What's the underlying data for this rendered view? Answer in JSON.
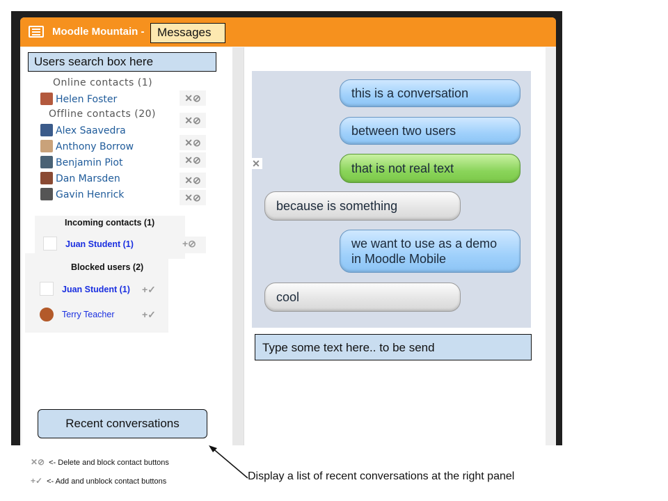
{
  "header": {
    "site_title": "Moodle Mountain -",
    "messages_callout": "Messages"
  },
  "search": {
    "callout": "Users search box here"
  },
  "contacts": {
    "online_heading": "Online contacts (1)",
    "online": [
      {
        "name": "Helen Foster"
      }
    ],
    "offline_heading": "Offline contacts (20)",
    "offline": [
      {
        "name": "Alex Saavedra"
      },
      {
        "name": "Anthony Borrow"
      },
      {
        "name": "Benjamin Piot"
      },
      {
        "name": "Dan Marsden"
      },
      {
        "name": "Gavin Henrick"
      }
    ],
    "contact_actions": "✕⊘"
  },
  "incoming": {
    "heading": "Incoming contacts (1)",
    "items": [
      {
        "name": "Juan Student (1)",
        "actions": "+⊘"
      }
    ]
  },
  "blocked": {
    "heading": "Blocked users (2)",
    "items": [
      {
        "name": "Juan Student (1)",
        "actions": "+✓"
      },
      {
        "name": "Terry Teacher",
        "actions": "+✓"
      }
    ]
  },
  "conversation": {
    "messages": [
      {
        "text": "this is a conversation",
        "side": "right",
        "color": "blue"
      },
      {
        "text": "between two users",
        "side": "right",
        "color": "blue"
      },
      {
        "text": "that is not real text",
        "side": "right",
        "color": "green"
      },
      {
        "text": "because is something",
        "side": "left",
        "color": "gray"
      },
      {
        "text": "we want to use as a demo",
        "text2": "in Moodle Mobile",
        "side": "right",
        "color": "blue"
      },
      {
        "text": "cool",
        "side": "left",
        "color": "gray"
      }
    ],
    "delete_mark": "✕"
  },
  "compose": {
    "callout": "Type some text here.. to be send"
  },
  "recent": {
    "callout": "Recent conversations"
  },
  "legend": {
    "delete_symbols": "✕⊘",
    "delete_text": "<- Delete and block contact buttons",
    "add_symbols": "+✓",
    "add_text": "<- Add and unblock contact buttons"
  },
  "note": "Display a list of recent conversations at the right panel",
  "colors": {
    "header": "#f6911e",
    "callout_blue": "#c9ddf0",
    "link": "#1f5b9a"
  }
}
